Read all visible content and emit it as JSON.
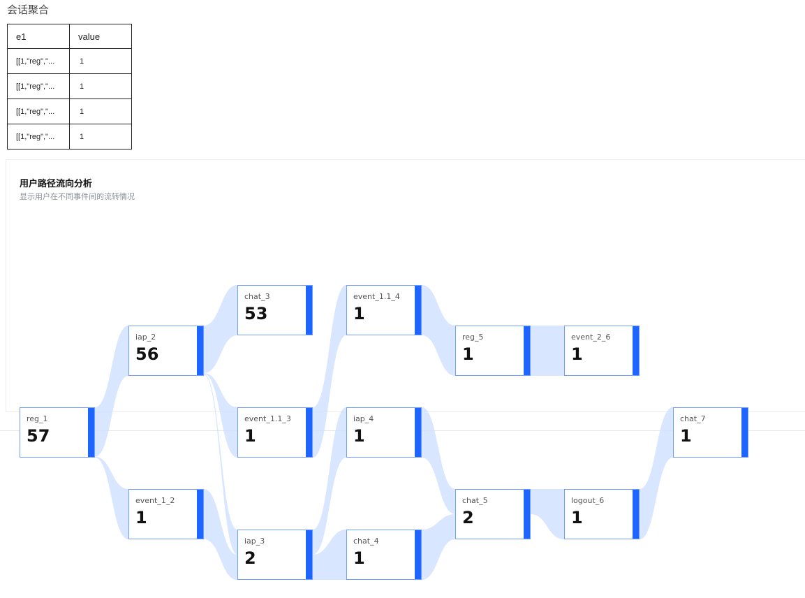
{
  "page": {
    "title": "会话聚合"
  },
  "table": {
    "columns": [
      "e1",
      "value"
    ],
    "rows": [
      [
        "[[1,\"reg\",\"...",
        "1"
      ],
      [
        "[[1,\"reg\",\"...",
        "1"
      ],
      [
        "[[1,\"reg\",\"...",
        "1"
      ],
      [
        "[[1,\"reg\",\"...",
        "1"
      ],
      [
        "",
        ""
      ]
    ]
  },
  "chart": {
    "title": "用户路径流向分析",
    "subtitle": "显示用户在不同事件间的流转情况",
    "colors": {
      "node_bar": "#1e64ff",
      "node_border": "#6f9eff",
      "link": "#cfe0ff"
    }
  },
  "chart_data": {
    "type": "sankey",
    "nodes": [
      {
        "id": "reg_1",
        "label": "reg_1",
        "value": "57",
        "step": 1
      },
      {
        "id": "iap_2",
        "label": "iap_2",
        "value": "56",
        "step": 2
      },
      {
        "id": "event_1_2",
        "label": "event_1_2",
        "value": "1",
        "step": 2
      },
      {
        "id": "chat_3",
        "label": "chat_3",
        "value": "53",
        "step": 3
      },
      {
        "id": "event_1.1_3",
        "label": "event_1.1_3",
        "value": "1",
        "step": 3
      },
      {
        "id": "iap_3",
        "label": "iap_3",
        "value": "2",
        "step": 3
      },
      {
        "id": "event_1.1_4",
        "label": "event_1.1_4",
        "value": "1",
        "step": 4
      },
      {
        "id": "iap_4",
        "label": "iap_4",
        "value": "1",
        "step": 4
      },
      {
        "id": "chat_4",
        "label": "chat_4",
        "value": "1",
        "step": 4
      },
      {
        "id": "reg_5",
        "label": "reg_5",
        "value": "1",
        "step": 5
      },
      {
        "id": "chat_5",
        "label": "chat_5",
        "value": "2",
        "step": 5
      },
      {
        "id": "event_2_6",
        "label": "event_2_6",
        "value": "1",
        "step": 6
      },
      {
        "id": "logout_6",
        "label": "logout_6",
        "value": "1",
        "step": 6
      },
      {
        "id": "chat_7",
        "label": "chat_7",
        "value": "1",
        "step": 7
      }
    ],
    "links": [
      {
        "source": "reg_1",
        "target": "iap_2",
        "value": 56
      },
      {
        "source": "reg_1",
        "target": "event_1_2",
        "value": 1
      },
      {
        "source": "iap_2",
        "target": "chat_3",
        "value": 53
      },
      {
        "source": "iap_2",
        "target": "event_1.1_3",
        "value": 1
      },
      {
        "source": "iap_2",
        "target": "iap_3",
        "value": 1
      },
      {
        "source": "event_1_2",
        "target": "iap_3",
        "value": 1
      },
      {
        "source": "event_1.1_3",
        "target": "event_1.1_4",
        "value": 1
      },
      {
        "source": "iap_3",
        "target": "iap_4",
        "value": 1
      },
      {
        "source": "iap_3",
        "target": "chat_4",
        "value": 1
      },
      {
        "source": "event_1.1_4",
        "target": "reg_5",
        "value": 1
      },
      {
        "source": "iap_4",
        "target": "chat_5",
        "value": 1
      },
      {
        "source": "chat_4",
        "target": "chat_5",
        "value": 1
      },
      {
        "source": "reg_5",
        "target": "event_2_6",
        "value": 1
      },
      {
        "source": "chat_5",
        "target": "logout_6",
        "value": 1
      },
      {
        "source": "logout_6",
        "target": "chat_7",
        "value": 1
      }
    ]
  }
}
